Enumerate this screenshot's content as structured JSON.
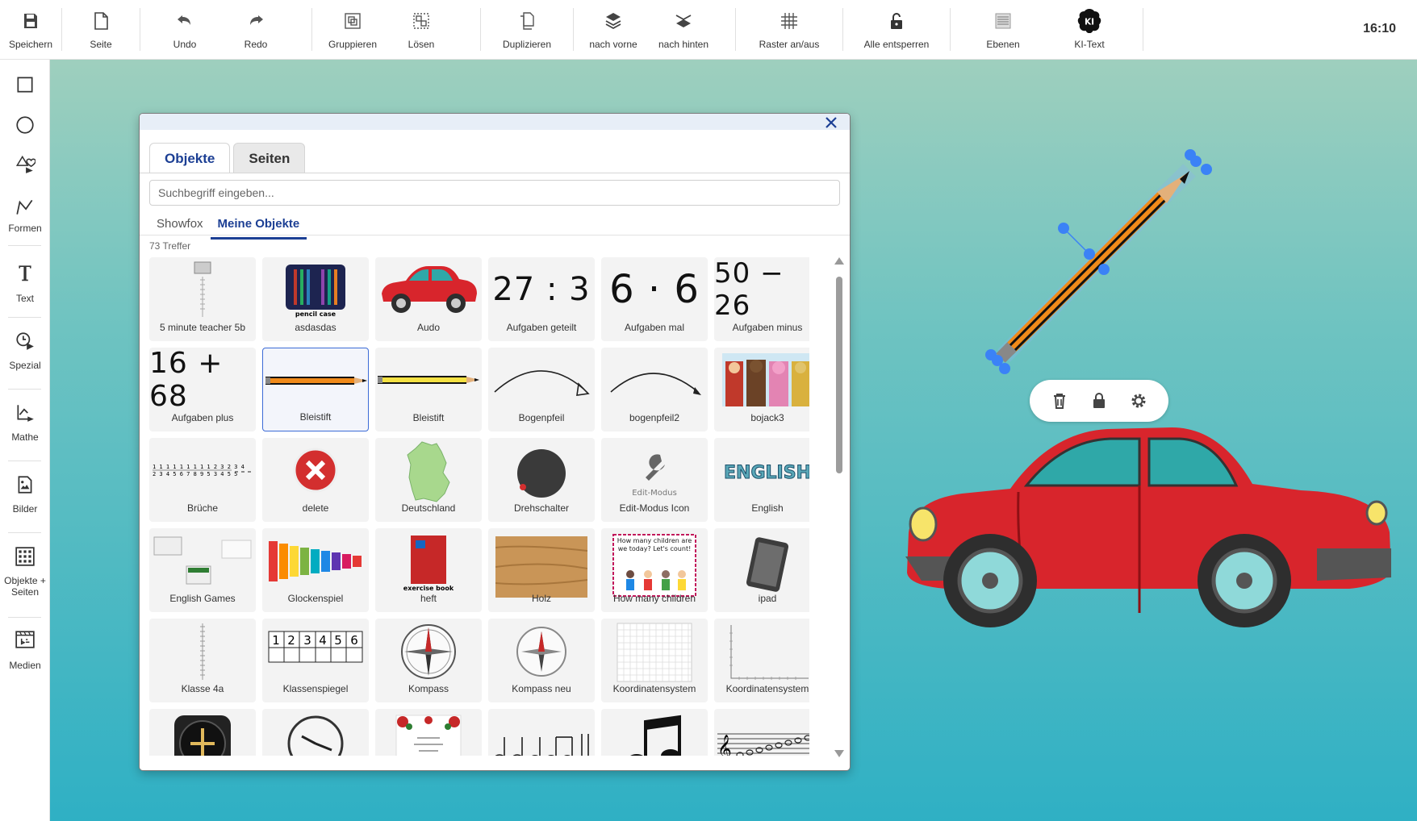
{
  "toolbar": {
    "items": [
      {
        "label": "Speichern",
        "icon": "save-icon"
      },
      {
        "label": "Seite",
        "icon": "page-icon"
      },
      {
        "label": "Undo",
        "icon": "undo-icon"
      },
      {
        "label": "Redo",
        "icon": "redo-icon"
      },
      {
        "label": "Gruppieren",
        "icon": "group-icon"
      },
      {
        "label": "Lösen",
        "icon": "ungroup-icon"
      },
      {
        "label": "Duplizieren",
        "icon": "duplicate-icon"
      },
      {
        "label": "nach vorne",
        "icon": "bring-forward-icon"
      },
      {
        "label": "nach hinten",
        "icon": "send-backward-icon"
      },
      {
        "label": "Raster an/aus",
        "icon": "grid-icon"
      },
      {
        "label": "Alle entsperren",
        "icon": "unlock-icon"
      },
      {
        "label": "Ebenen",
        "icon": "layers-icon"
      },
      {
        "label": "KI-Text",
        "icon": "ai-brain-icon"
      }
    ],
    "time": "16:10"
  },
  "sidebar": {
    "items": [
      {
        "label": "",
        "icon": "square-icon"
      },
      {
        "label": "",
        "icon": "circle-icon"
      },
      {
        "label": "",
        "icon": "shapes-icon"
      },
      {
        "label": "Formen",
        "icon": "polyline-icon"
      },
      {
        "label": "Text",
        "icon": "text-icon"
      },
      {
        "label": "Spezial",
        "icon": "timer-icon"
      },
      {
        "label": "Mathe",
        "icon": "math-icon"
      },
      {
        "label": "Bilder",
        "icon": "image-icon"
      },
      {
        "label": "Objekte + Seiten",
        "icon": "objects-grid-icon"
      },
      {
        "label": "Medien",
        "icon": "media-icon"
      }
    ]
  },
  "dialog": {
    "tabs": [
      "Objekte",
      "Seiten"
    ],
    "active_tab": "Objekte",
    "search_placeholder": "Suchbegriff eingeben...",
    "subtabs": [
      "Showfox",
      "Meine Objekte"
    ],
    "active_subtab": "Meine Objekte",
    "result_count": "73 Treffer",
    "items": [
      {
        "label": "5 minute teacher 5b",
        "thumb": "document-thumb"
      },
      {
        "label": "asdasdas",
        "thumb": "pencil-case-thumb",
        "caption": "pencil case"
      },
      {
        "label": "Audo",
        "thumb": "red-car-thumb"
      },
      {
        "label": "Aufgaben geteilt",
        "thumb": "math-text",
        "text": "27 : 3"
      },
      {
        "label": "Aufgaben mal",
        "thumb": "math-text",
        "text": "6 · 6"
      },
      {
        "label": "Aufgaben minus",
        "thumb": "math-text",
        "text": "50 − 26"
      },
      {
        "label": "Aufgaben plus",
        "thumb": "math-text",
        "text": "16 + 68"
      },
      {
        "label": "Bleistift",
        "thumb": "pencil-thumb",
        "selected": true
      },
      {
        "label": "Bleistift",
        "thumb": "yellow-pencil-thumb"
      },
      {
        "label": "Bogenpfeil",
        "thumb": "curved-arrow-thumb"
      },
      {
        "label": "bogenpfeil2",
        "thumb": "curved-arrow2-thumb"
      },
      {
        "label": "bojack3",
        "thumb": "cartoon-thumb"
      },
      {
        "label": "Brüche",
        "thumb": "fractions-thumb"
      },
      {
        "label": "delete",
        "thumb": "delete-thumb"
      },
      {
        "label": "Deutschland",
        "thumb": "germany-map-thumb"
      },
      {
        "label": "Drehschalter",
        "thumb": "knob-thumb"
      },
      {
        "label": "Edit-Modus Icon",
        "thumb": "wrench-thumb",
        "caption": "Edit-Modus"
      },
      {
        "label": "English",
        "thumb": "english-thumb",
        "caption": "ENGLISH"
      },
      {
        "label": "English Games",
        "thumb": "games-thumb"
      },
      {
        "label": "Glockenspiel",
        "thumb": "xylophone-thumb"
      },
      {
        "label": "heft",
        "thumb": "exercise-book-thumb",
        "caption": "exercise book"
      },
      {
        "label": "Holz",
        "thumb": "wood-thumb"
      },
      {
        "label": "How many children",
        "thumb": "children-thumb",
        "caption": "How many children are we today? Let's count!"
      },
      {
        "label": "ipad",
        "thumb": "ipad-thumb"
      },
      {
        "label": "Klasse 4a",
        "thumb": "list-thumb"
      },
      {
        "label": "Klassenspiegel",
        "thumb": "seating-thumb",
        "numbers": [
          "1",
          "2",
          "3",
          "4",
          "5",
          "6"
        ]
      },
      {
        "label": "Kompass",
        "thumb": "compass-thumb"
      },
      {
        "label": "Kompass neu",
        "thumb": "compass-new-thumb"
      },
      {
        "label": "Koordinatensystem",
        "thumb": "coordinate-grid-thumb"
      },
      {
        "label": "Koordinatensystem",
        "thumb": "coordinate-axis-thumb"
      },
      {
        "label": "",
        "thumb": "aviation-clock-thumb"
      },
      {
        "label": "",
        "thumb": "wall-clock-thumb"
      },
      {
        "label": "",
        "thumb": "roses-card-thumb"
      },
      {
        "label": "",
        "thumb": "notes-thumb"
      },
      {
        "label": "",
        "thumb": "eighth-notes-thumb"
      },
      {
        "label": "",
        "thumb": "staff-thumb"
      }
    ]
  },
  "canvas": {
    "object_toolbar": [
      "delete-icon",
      "lock-icon",
      "settings-icon"
    ]
  },
  "colors": {
    "accent": "#1c3f94",
    "handle": "#3b82f6",
    "car_red": "#d8252c"
  }
}
